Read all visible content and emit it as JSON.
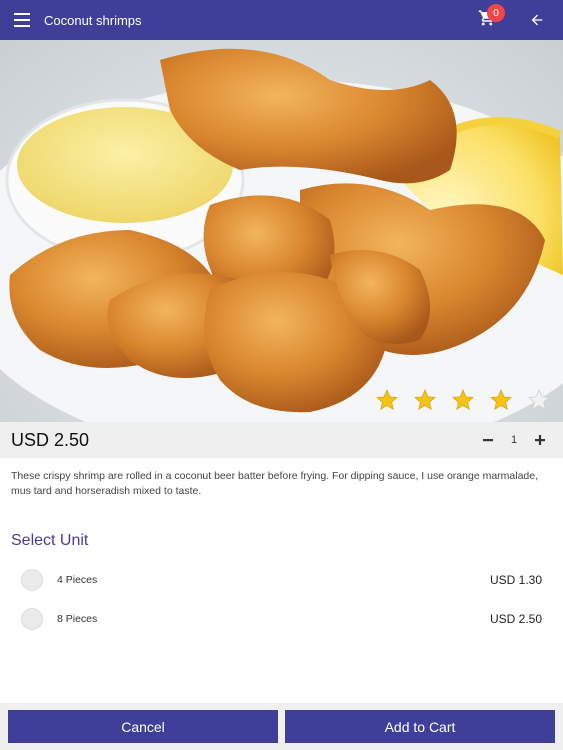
{
  "appbar": {
    "title": "Coconut shrimps",
    "menu_icon": "hamburger-menu-icon",
    "cart_icon": "shopping-cart-icon",
    "cart_count": "0",
    "back_icon": "arrow-back-icon",
    "background_color": "#3f3f99",
    "badge_color": "#f0464a"
  },
  "product": {
    "image_alt": "Coconut shrimps with dipping sauce and lemon",
    "rating": 4,
    "rating_max": 5,
    "star_color": "#f5c21b",
    "price": "USD 2.50",
    "quantity": "1",
    "description": "These crispy shrimp are rolled in a coconut beer batter before frying. For dipping sauce, I use orange marmalade, mus tard and horseradish mixed to taste."
  },
  "units": {
    "title": "Select Unit",
    "items": [
      {
        "name": "4 Pieces",
        "price": "USD 1.30"
      },
      {
        "name": "8 Pieces",
        "price": "USD 2.50"
      }
    ]
  },
  "actions": {
    "cancel_label": "Cancel",
    "add_label": "Add to Cart",
    "button_color": "#3f3f99"
  }
}
